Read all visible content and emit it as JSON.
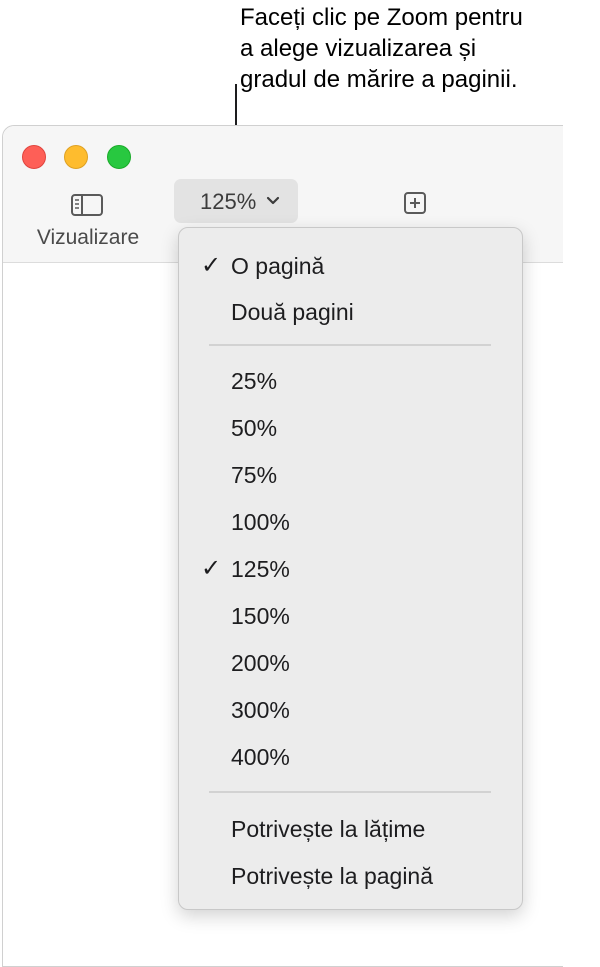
{
  "callout": {
    "line1": "Faceți clic pe Zoom pentru",
    "line2": "a alege vizualizarea și",
    "line3": "gradul de mărire a paginii."
  },
  "window": {
    "traffic_lights": {
      "close_color": "#fe5f57",
      "minimize_color": "#febc2e",
      "zoom_color": "#28c840"
    },
    "toolbar": {
      "view_label": "Vizualizare",
      "view_icon": "sidebar-icon",
      "zoom_value": "125%",
      "zoom_icon": "chevron-down-icon",
      "add_icon": "plus-square-icon"
    }
  },
  "menu": {
    "check_glyph": "✓",
    "page_items": [
      {
        "label": "O pagină",
        "checked": true
      },
      {
        "label": "Două pagini",
        "checked": false
      }
    ],
    "zoom_items": [
      {
        "label": "25%",
        "checked": false
      },
      {
        "label": "50%",
        "checked": false
      },
      {
        "label": "75%",
        "checked": false
      },
      {
        "label": "100%",
        "checked": false
      },
      {
        "label": "125%",
        "checked": true
      },
      {
        "label": "150%",
        "checked": false
      },
      {
        "label": "200%",
        "checked": false
      },
      {
        "label": "300%",
        "checked": false
      },
      {
        "label": "400%",
        "checked": false
      }
    ],
    "fit_items": [
      {
        "label": "Potrivește la lățime",
        "checked": false
      },
      {
        "label": "Potrivește la pagină",
        "checked": false
      }
    ]
  }
}
